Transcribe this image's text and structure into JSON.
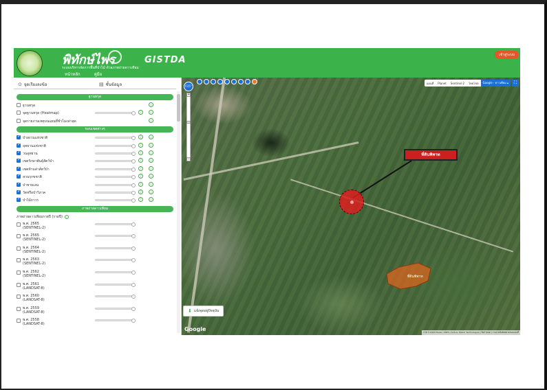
{
  "header": {
    "brand_title": "พิทักษ์ไพร",
    "brand_subtitle": "ระบบบริหารจัดการพื้นที่ป่าไม้ ด้วยภาพถ่ายดาวเทียม",
    "gistda_logo": "GISTDA",
    "tabs": [
      {
        "label": "หน้าหลัก",
        "active": true
      },
      {
        "label": "คู่มือ",
        "active": false
      }
    ],
    "login_label": "เข้าสู่ระบบ"
  },
  "sidebar": {
    "tabs": [
      {
        "icon": "location-pin-icon",
        "label": "จุดเรียงลงข้อ"
      },
      {
        "icon": "layers-icon",
        "label": "ชั้นข้อมูล"
      }
    ],
    "sections": [
      {
        "title": "ฐานทรุด",
        "rows": [
          {
            "label": "ฐานทรุด",
            "checked": false,
            "slider": false
          },
          {
            "label": "จุดฐานทรุด (Heatmap)",
            "checked": false,
            "slider": true
          },
          {
            "label": "จุดรายงานเหตุบนแผนที่ชั่วโมงล่าสุด",
            "checked": false,
            "slider": false
          }
        ]
      },
      {
        "title": "ขอบเขตต่างๆ",
        "rows": [
          {
            "label": "ป่าสงวนแห่งชาติ",
            "checked": true,
            "slider": true
          },
          {
            "label": "อุทยานแห่งชาติ",
            "checked": true,
            "slider": true
          },
          {
            "label": "วนอุทยาน",
            "checked": true,
            "slider": true
          },
          {
            "label": "เขตรักษาพันธุ์สัตว์ป่า",
            "checked": true,
            "slider": true
          },
          {
            "label": "เขตห้ามล่าสัตว์ป่า",
            "checked": true,
            "slider": true
          },
          {
            "label": "สวนรุกขชาติ",
            "checked": true,
            "slider": true
          },
          {
            "label": "ป่าชายเลน",
            "checked": true,
            "slider": true
          },
          {
            "label": "วัดหรือป่าวิภาค",
            "checked": true,
            "slider": true
          },
          {
            "label": "ป่าไม้ถาวร",
            "checked": true,
            "slider": true
          }
        ]
      },
      {
        "title": "ภาพถ่ายดาวเทียม",
        "subtitle": "ภาพถ่ายดาวเทียมรายปี (รายปี)",
        "years": [
          {
            "year": "พ.ศ. 2565",
            "sensor": "(SENTINEL-2)"
          },
          {
            "year": "พ.ศ. 2565",
            "sensor": "(SENTINEL-2)"
          },
          {
            "year": "พ.ศ. 2564",
            "sensor": "(SENTINEL-2)"
          },
          {
            "year": "พ.ศ. 2563",
            "sensor": "(SENTINEL-2)"
          },
          {
            "year": "พ.ศ. 2562",
            "sensor": "(SENTINEL-2)"
          },
          {
            "year": "พ.ศ. 2561",
            "sensor": "(LANDSAT-8)"
          },
          {
            "year": "พ.ศ. 2560",
            "sensor": "(LANDSAT-8)"
          },
          {
            "year": "พ.ศ. 2559",
            "sensor": "(LANDSAT-8)"
          },
          {
            "year": "พ.ศ. 2558",
            "sensor": "(LANDSAT-8)"
          }
        ]
      }
    ]
  },
  "map": {
    "compass_label": "€15°",
    "basemaps": [
      {
        "label": "แผนที่",
        "active": false
      },
      {
        "label": "Planet",
        "active": false
      },
      {
        "label": "Sentinel-2",
        "active": false
      },
      {
        "label": "ไทยโชต",
        "active": false
      },
      {
        "label": "Google - ดาวเทียม",
        "active": true
      }
    ],
    "callout_text": "ที่ดินพิพาท",
    "parcel_label": "ที่ดินพิพาท",
    "gps_button_label": "แจ้งจุดอยู่ปัจจุบัน",
    "google_logo": "Google",
    "attribution": "ภาพ ©2023 Maxar, CNES / Airbus, Maxar Technologies | ข้อกำหนด | รายงานข้อผิดพลาดของแผนที่"
  },
  "colors": {
    "header_green": "#3bb34a",
    "section_green": "#46b556",
    "accent_blue": "#1d6fd6",
    "login_orange": "#e6562a",
    "callout_red": "#cc1f1f",
    "parcel_orange": "#d9661f"
  }
}
